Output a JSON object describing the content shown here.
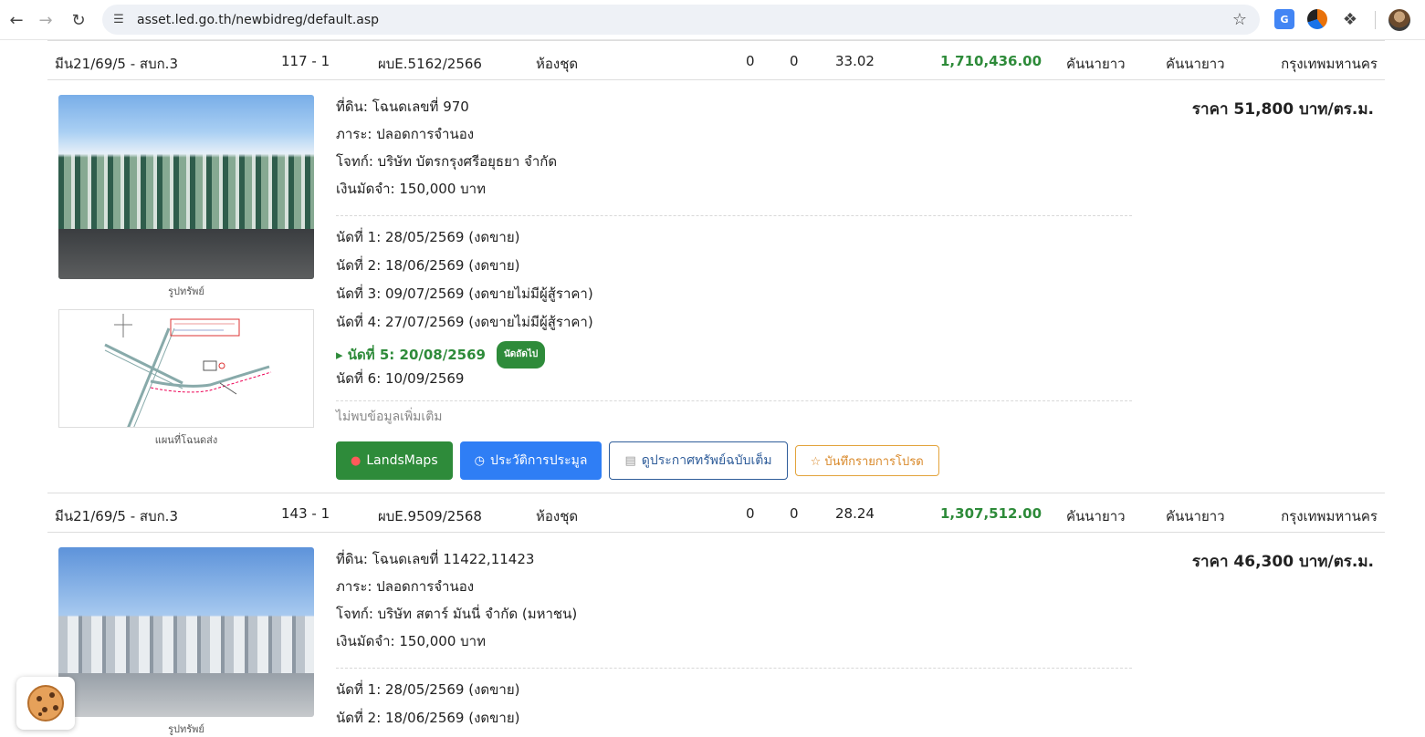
{
  "browser": {
    "url": "asset.led.go.th/newbidreg/default.asp"
  },
  "listings": [
    {
      "row": {
        "date": "มีน21/69/5 - สบก.3",
        "lot": "117 - 1",
        "case": "ผบE.5162/2566",
        "type": "ห้องชุด",
        "a": "0",
        "b": "0",
        "area": "33.02",
        "price": "1,710,436.00",
        "district": "คันนายาว",
        "subdistrict": "คันนายาว",
        "province": "กรุงเทพมหานคร"
      },
      "photo_caption": "รูปทรัพย์",
      "map_caption": "แผนที่โฉนดส่ง",
      "land": "ที่ดิน: โฉนดเลขที่ 970",
      "burden": "ภาระ: ปลอดการจำนอง",
      "plaintiff": "โจทก์: บริษัท บัตรกรุงศรีอยุธยา จำกัด",
      "deposit": "เงินมัดจำ: 150,000 บาท",
      "unit_price": "ราคา 51,800 บาท/ตร.ม.",
      "dates": [
        "นัดที่ 1: 28/05/2569 (งดขาย)",
        "นัดที่ 2: 18/06/2569 (งดขาย)",
        "นัดที่ 3: 09/07/2569 (งดขายไม่มีผู้สู้ราคา)",
        "นัดที่ 4: 27/07/2569 (งดขายไม่มีผู้สู้ราคา)"
      ],
      "active_date": "▸ นัดที่ 5: 20/08/2569",
      "active_badge": "นัดถัดไป",
      "after_dates": [
        "นัดที่ 6: 10/09/2569"
      ],
      "no_more": "ไม่พบข้อมูลเพิ่มเติม",
      "buttons": {
        "landsmaps": "LandsMaps",
        "history": "ประวัติการประมูล",
        "announcement": "ดูประกาศทรัพย์ฉบับเต็ม",
        "favorite": "☆ บันทึกรายการโปรด"
      }
    },
    {
      "row": {
        "date": "มีน21/69/5 - สบก.3",
        "lot": "143 - 1",
        "case": "ผบE.9509/2568",
        "type": "ห้องชุด",
        "a": "0",
        "b": "0",
        "area": "28.24",
        "price": "1,307,512.00",
        "district": "คันนายาว",
        "subdistrict": "คันนายาว",
        "province": "กรุงเทพมหานคร"
      },
      "photo_caption": "รูปทรัพย์",
      "land": "ที่ดิน: โฉนดเลขที่ 11422,11423",
      "burden": "ภาระ: ปลอดการจำนอง",
      "plaintiff": "โจทก์: บริษัท สตาร์ มันนี่ จำกัด (มหาชน)",
      "deposit": "เงินมัดจำ: 150,000 บาท",
      "unit_price": "ราคา 46,300 บาท/ตร.ม.",
      "dates": [
        "นัดที่ 1: 28/05/2569 (งดขาย)",
        "นัดที่ 2: 18/06/2569 (งดขาย)"
      ]
    }
  ],
  "colors": {
    "green": "#2e8b3a",
    "blue": "#2f7ef5"
  }
}
